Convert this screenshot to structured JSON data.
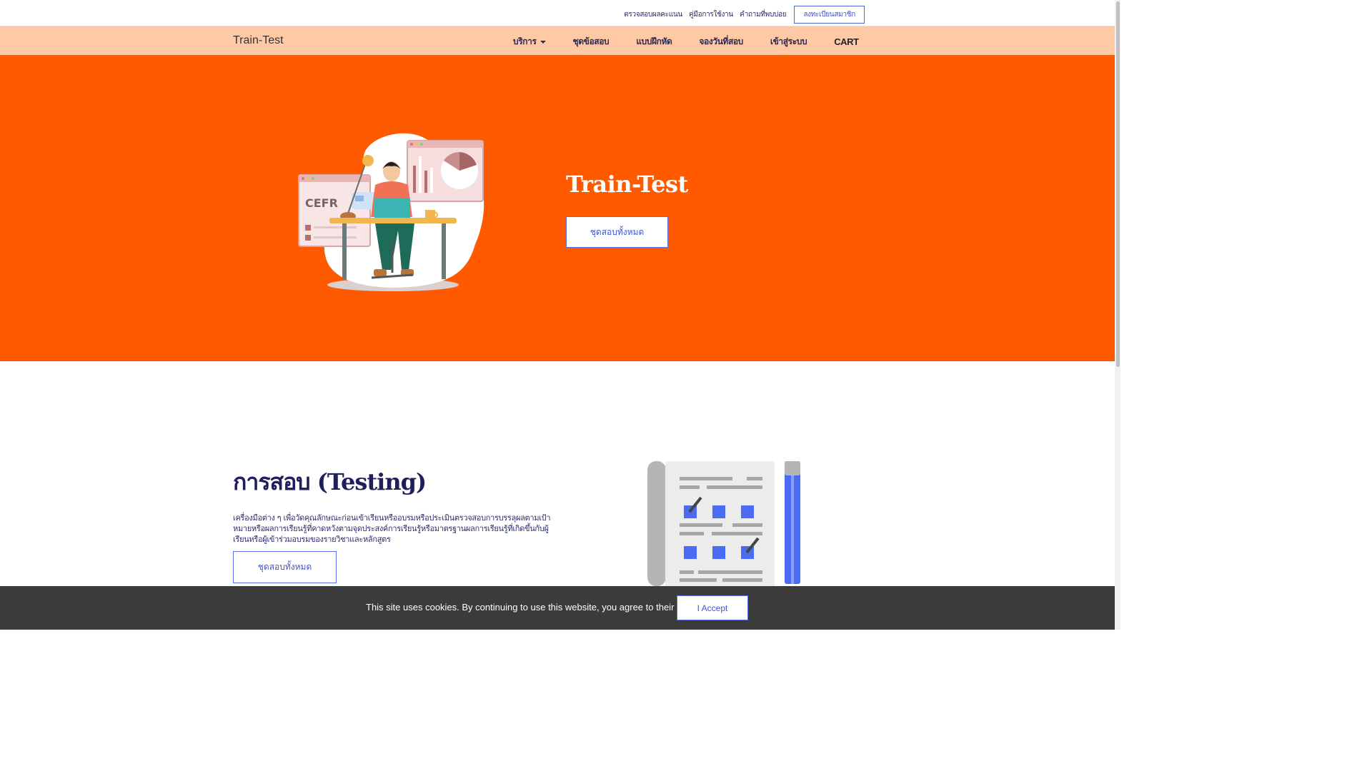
{
  "topbar": {
    "links": [
      "ตรวจสอบผลคะแนน",
      "คู่มือการใช้งาน",
      "คำถามที่พบบ่อย"
    ],
    "register_label": "ลงทะเบียนสมาชิก"
  },
  "navbar": {
    "brand": "Train-Test",
    "services_label": "บริการ",
    "items": [
      "ชุดข้อสอบ",
      "แบบฝึกหัด",
      "จองวันที่สอบ",
      "เข้าสู่ระบบ"
    ],
    "cart_label": "CART"
  },
  "hero": {
    "title": "Train-Test",
    "button_label": "ชุดสอบทั้งหมด",
    "illustration_text": "CEFR"
  },
  "testing": {
    "title": "การสอบ (Testing)",
    "description": "เครื่องมือต่าง ๆ เพื่อวัดคุณลักษณะก่อนเข้าเรียนหรืออบรมหรือประเมินตรวจสอบการบรรลุผลตามเป้าหมายหรือผลการเรียนรู้ที่คาดหวังตามจุดประสงค์การเรียนรู้หรือมาตรฐานผลการเรียนรู้ที่เกิดขึ้นกับผู้เรียนหรือผู้เข้าร่วมอบรมของรายวิชาและหลักสูตร",
    "button_label": "ชุดสอบทั้งหมด"
  },
  "cookie": {
    "text": "This site uses cookies. By continuing to use this website, you agree to their use.",
    "accept_label": "I Accept"
  },
  "colors": {
    "hero_bg": "#ff5a00",
    "navbar_bg": "#ffc9a6",
    "accent": "#3e55d6",
    "heading": "#1f1f5c",
    "cookie_bg": "#3b3b3b"
  }
}
